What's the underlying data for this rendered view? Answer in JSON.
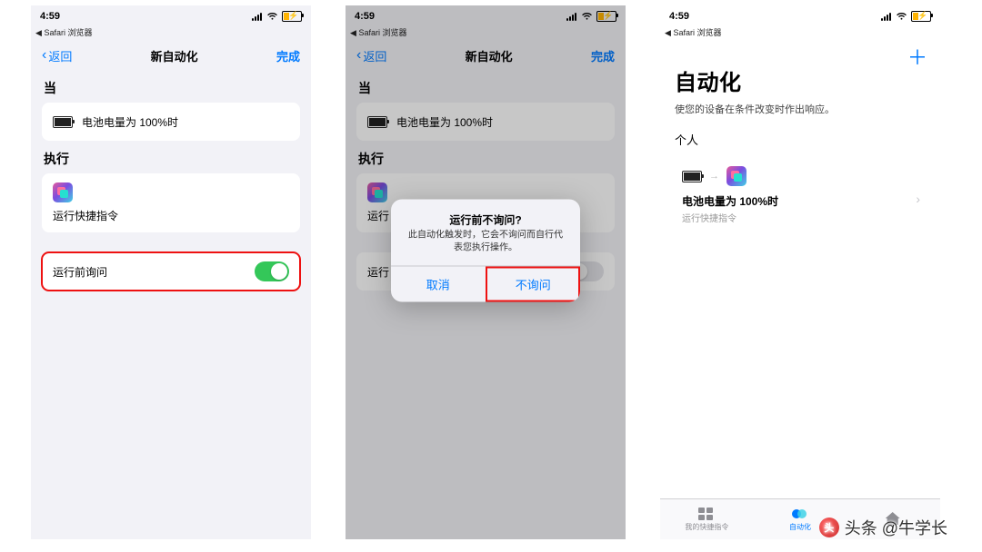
{
  "status": {
    "time": "4:59",
    "back_app": "Safari 浏览器"
  },
  "nav": {
    "back": "返回",
    "title": "新自动化",
    "done": "完成"
  },
  "s1": {
    "when": "当",
    "when_text": "电池电量为 100%时",
    "do": "执行",
    "do_text": "运行快捷指令",
    "ask": "运行前询问"
  },
  "dialog": {
    "title": "运行前不询问?",
    "msg": "此自动化触发时，它会不询问而自行代表您执行操作。",
    "cancel": "取消",
    "ok": "不询问"
  },
  "s2_ask_prefix": "运行",
  "s3": {
    "title": "自动化",
    "subtitle": "使您的设备在条件改变时作出响应。",
    "section": "个人",
    "card_title": "电池电量为 100%时",
    "card_sub": "运行快捷指令",
    "tabs": {
      "gallery": "我的快捷指令",
      "automation": "自动化",
      "home": ""
    }
  },
  "watermark": "头条 @牛学长"
}
